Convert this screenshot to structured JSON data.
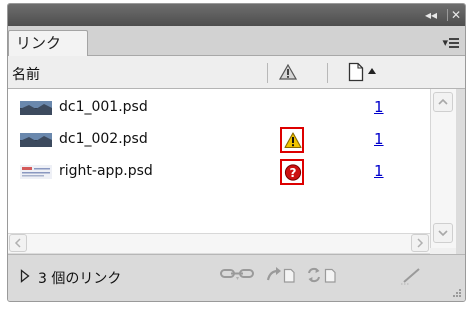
{
  "panel": {
    "titlebar": {
      "collapse_label": "◂◂",
      "close_label": "✕"
    },
    "tab": {
      "label": "リンク"
    },
    "columns": {
      "name_header": "名前"
    },
    "files": [
      {
        "name": "dc1_001.psd",
        "status": "",
        "page": "1",
        "thumb": "photo"
      },
      {
        "name": "dc1_002.psd",
        "status": "warning",
        "page": "1",
        "thumb": "photo"
      },
      {
        "name": "right-app.psd",
        "status": "missing",
        "page": "1",
        "thumb": "document"
      }
    ],
    "footer": {
      "count_label": "3 個のリンク"
    }
  },
  "colors": {
    "warning": "#f0c400",
    "missing": "#cc1111",
    "highlight_border": "#dd0000",
    "page_link": "#0000cc",
    "titlebar": "#5a5a5a"
  }
}
